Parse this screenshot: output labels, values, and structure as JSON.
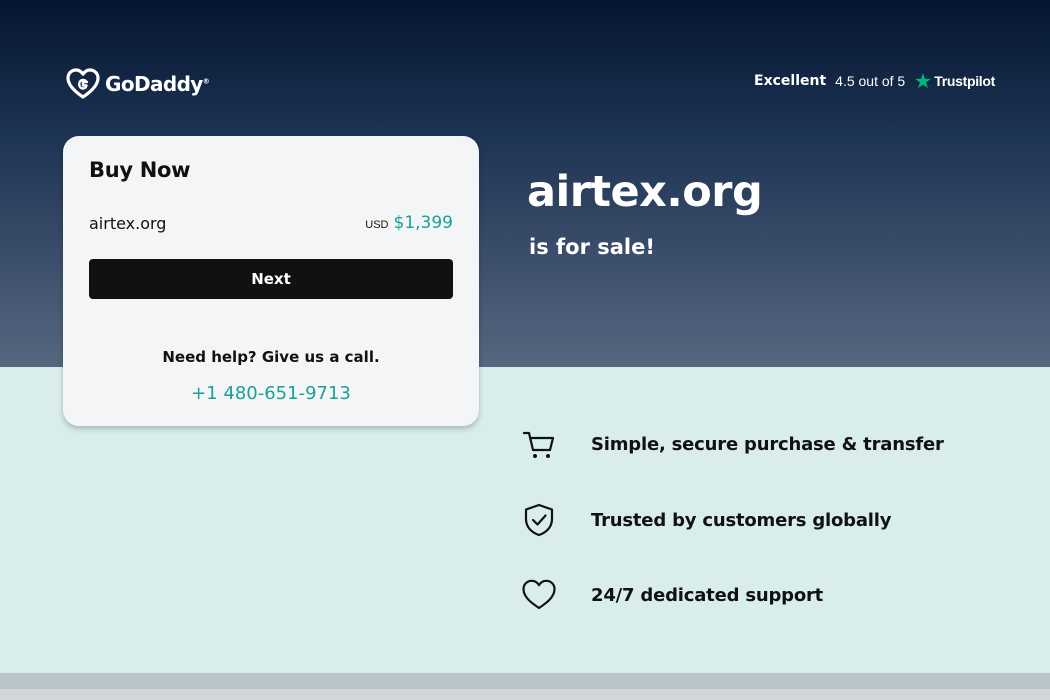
{
  "brand": {
    "name": "GoDaddy",
    "trademark": "®"
  },
  "rating": {
    "label": "Excellent",
    "score": "4.5 out of 5",
    "provider": "Trustpilot"
  },
  "card": {
    "title": "Buy Now",
    "domain": "airtex.org",
    "currency": "USD",
    "price": "$1,399",
    "next_label": "Next",
    "help_text": "Need help? Give us a call.",
    "phone": "+1 480-651-9713"
  },
  "hero": {
    "domain": "airtex.org",
    "subtitle": "is for sale!"
  },
  "features": [
    {
      "icon": "cart-icon",
      "label": "Simple, secure purchase & transfer"
    },
    {
      "icon": "shield-check-icon",
      "label": "Trusted by customers globally"
    },
    {
      "icon": "heart-icon",
      "label": "24/7 dedicated support"
    }
  ],
  "colors": {
    "accent": "#1aa195",
    "button": "#111111",
    "hero_top": "#041530",
    "hero_bottom": "#56677f",
    "lower_bg": "#d9eeeb",
    "trustpilot": "#00b67a"
  }
}
